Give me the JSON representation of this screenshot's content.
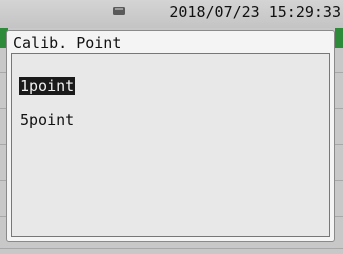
{
  "status": {
    "icon": "sd-card-icon",
    "datetime": "2018/07/23 15:29:33"
  },
  "dialog": {
    "title": "Calib. Point",
    "options": [
      {
        "label": "1point",
        "selected": true
      },
      {
        "label": "5point",
        "selected": false
      }
    ]
  },
  "colors": {
    "accent_green": "#2e8b3a",
    "selection_bg": "#1a1a1a"
  }
}
